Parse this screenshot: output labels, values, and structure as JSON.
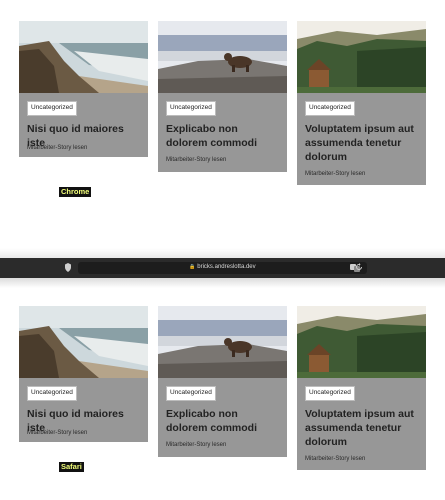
{
  "browser": {
    "address": "bricks.andreslotta.dev"
  },
  "labels": {
    "chrome": "Chrome",
    "safari": "Safari"
  },
  "cards": [
    {
      "category": "Uncategorized",
      "title": "Nisi quo id maiores iste",
      "link": "Mitarbeiter-Story lesen",
      "image": "coast-cliff-beach"
    },
    {
      "category": "Uncategorized",
      "title": "Explicabo non dolorem commodi",
      "link": "Mitarbeiter-Story lesen",
      "image": "bear-on-rocks"
    },
    {
      "category": "Uncategorized",
      "title": "Voluptatem ipsum aut assumenda tenetur dolorum",
      "link": "Mitarbeiter-Story lesen",
      "image": "forest-cabin"
    }
  ],
  "colors": {
    "card_bg": "#979797",
    "label_bg": "#111111",
    "label_text": "#f3ff7a",
    "topbar_bg": "#2b2b2b"
  }
}
